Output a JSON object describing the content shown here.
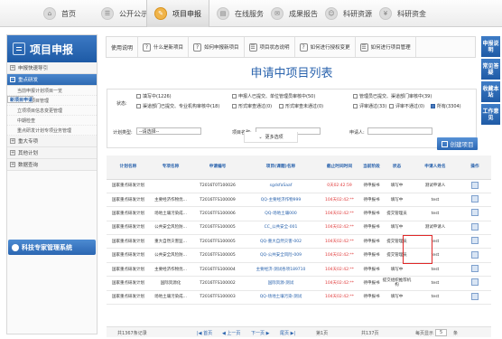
{
  "topnav": [
    {
      "label": "首页",
      "icon": "home-icon",
      "glyph": "⌂"
    },
    {
      "label": "公开公示",
      "icon": "announce-icon",
      "glyph": "☰"
    },
    {
      "label": "项目申报",
      "icon": "pencil-icon",
      "glyph": "✎",
      "active": true
    },
    {
      "label": "在线服务",
      "icon": "bookmark-icon",
      "glyph": "▤"
    },
    {
      "label": "成果报告",
      "icon": "chat-icon",
      "glyph": "✉"
    },
    {
      "label": "科研资源",
      "icon": "user-icon",
      "glyph": "☺"
    },
    {
      "label": "科研资金",
      "icon": "money-icon",
      "glyph": "¥"
    }
  ],
  "sidebar": {
    "title": "项目申报",
    "sections": [
      {
        "label": "申报快速导引",
        "open": false,
        "items": []
      },
      {
        "label": "重点研发",
        "open": true,
        "items": [
          {
            "label": "当前申报计划项目一览",
            "selected": false
          },
          {
            "label": "新项目申请",
            "selected": true
          },
          {
            "label": "已立项项目管理",
            "selected": false
          },
          {
            "label": "立项项目信息变更管理",
            "selected": false
          },
          {
            "label": "中期检查",
            "selected": false
          },
          {
            "label": "重点研发计划专项业务管理",
            "selected": false
          }
        ]
      },
      {
        "label": "重大专项",
        "open": false,
        "items": []
      },
      {
        "label": "其他计划",
        "open": false,
        "items": []
      },
      {
        "label": "数据查询",
        "open": false,
        "items": []
      }
    ],
    "expert": "科技专家管理系统"
  },
  "toolbar": [
    {
      "label": "使用说明",
      "icon": ""
    },
    {
      "label": "什么是新项目",
      "icon": "?"
    },
    {
      "label": "如何申报新项目",
      "icon": "?"
    },
    {
      "label": "项目状态说明",
      "icon": "☰"
    },
    {
      "label": "如何进行授权变更",
      "icon": "?"
    },
    {
      "label": "如何进行项目管理",
      "icon": "☰"
    }
  ],
  "rightnav": [
    "申报说明",
    "常见答疑",
    "收藏本站",
    "工作意见"
  ],
  "page_title": "申请中项目列表",
  "filters": {
    "status_label": "状态:",
    "status_options": [
      {
        "label": "填写中(1226)",
        "checked": false
      },
      {
        "label": "申报人已提交、单位管理员审核中(50)",
        "checked": false
      },
      {
        "label": "管理员已提交、渠道部门审核中(39)",
        "checked": false
      },
      {
        "label": "渠道部门已提交、专业机构审核中(18)",
        "checked": false
      },
      {
        "label": "形式审查通过(0)",
        "checked": false
      },
      {
        "label": "形式审查未通过(0)",
        "checked": false
      },
      {
        "label": "评审通过(33)",
        "checked": false
      },
      {
        "label": "评审不通过(0)",
        "checked": false
      },
      {
        "label": "所有(3304)",
        "checked": true
      }
    ],
    "plan_type_label": "计划类型:",
    "plan_type_value": "--请选择--",
    "project_name_label": "项目名称:",
    "applicant_label": "申请人:",
    "more_label": "更多选项"
  },
  "create_button": "创建项目",
  "table": {
    "headers": [
      "计划名称",
      "专项名称",
      "申请编号",
      "项目(课题)名称",
      "截止时间时间",
      "当前阶段",
      "状态",
      "申请人姓名",
      "操作"
    ],
    "rows": [
      [
        "国家重点研发计划",
        "",
        "T2016T0T100026",
        "sgdsfaSaaf",
        "0天02:42:59",
        "待申报书",
        "填写中",
        "测试申请人",
        ""
      ],
      [
        "国家重点研发计划",
        "主要经济作物优...",
        "T2016TFS100009",
        "QQ-主要经济作物999",
        "104天02:42:**",
        "待申报书",
        "填写中",
        "test",
        ""
      ],
      [
        "国家重点研发计划",
        "场地土壤污染成...",
        "T2016TFS100006",
        "QQ-场地土壤000",
        "104天02:42:**",
        "待申报书",
        "提交管理员",
        "test",
        ""
      ],
      [
        "国家重点研发计划",
        "公共安全风险防...",
        "T2016TFS100005",
        "CC_公共安全-001",
        "104天02:42:**",
        "待申报书",
        "填写中",
        "测试申请人",
        ""
      ],
      [
        "国家重点研发计划",
        "重大自然灾害监...",
        "T2016TFS100005",
        "QQ-重大自然灾害-002",
        "104天02:42:**",
        "待申报书",
        "提交管理员",
        "test",
        ""
      ],
      [
        "国家重点研发计划",
        "公共安全风险防...",
        "T2016TFS100005",
        "QQ-公共安全风险-009",
        "104天02:42:**",
        "待申报书",
        "提交管理员",
        "test",
        ""
      ],
      [
        "国家重点研发计划",
        "主要经济作物优...",
        "T2016TFS100004",
        "主要经济-测试各项189710",
        "104天02:42:**",
        "待申报书",
        "填写中",
        "test",
        ""
      ],
      [
        "国家重点研发计划",
        "国际资源化",
        "T2016TFS100002",
        "国际资源-测试",
        "104天02:42:**",
        "待申报书",
        "提交组织推荐机构",
        "test",
        ""
      ],
      [
        "国家重点研发计划",
        "场地土壤污染成...",
        "T2016TFS100003",
        "QQ-场地土壤污染-测试",
        "104天02:42:**",
        "待申报书",
        "填写中",
        "test",
        ""
      ]
    ]
  },
  "pager": {
    "total": "共1367条记录",
    "first": "|◀ 首页",
    "prev": "◀ 上一页",
    "next": "下一页 ▶",
    "last": "尾页 ▶|",
    "page_info": "第1页",
    "page_count": "共137页",
    "per_page_label": "每页显示",
    "per_page_value": "5",
    "per_page_unit": "条"
  }
}
